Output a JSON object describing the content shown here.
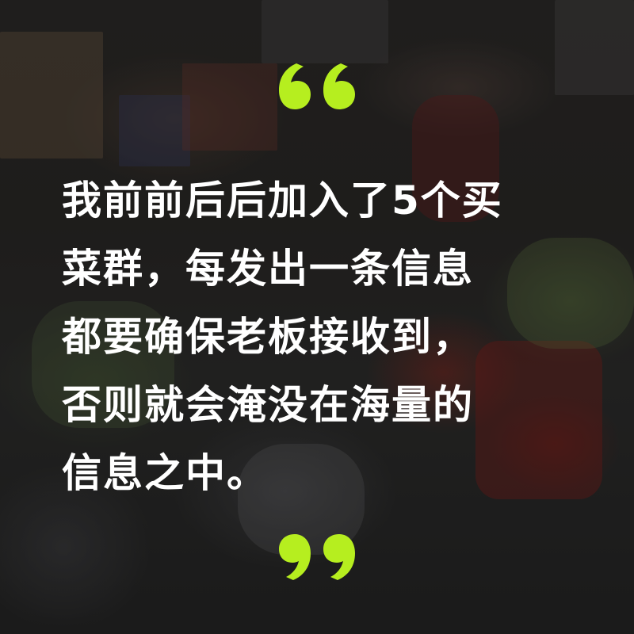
{
  "quote": {
    "lines": [
      "我前前后后加入了5个买",
      "菜群，每发出一条信息",
      "都要确保老板接收到，",
      "否则就会淹没在海量的",
      "信息之中。"
    ]
  },
  "colors": {
    "accent": "#b6ee1f",
    "text": "#ffffff",
    "overlay": "#1b1a19"
  },
  "icons": {
    "open": "open-quote-icon",
    "close": "close-quote-icon"
  }
}
